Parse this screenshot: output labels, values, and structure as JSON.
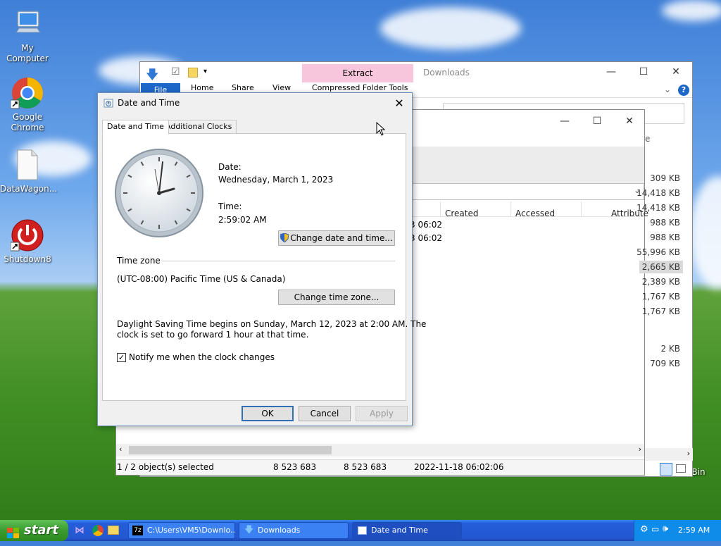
{
  "desktop": {
    "icons": [
      {
        "label": "My Computer",
        "icon": "computer-icon"
      },
      {
        "label": "Google Chrome",
        "icon": "chrome-icon"
      },
      {
        "label": "DataWagon...",
        "icon": "file-icon"
      },
      {
        "label": "Shutdown8",
        "icon": "power-icon"
      },
      {
        "label": "Bin",
        "icon": "recycle-bin-icon"
      }
    ]
  },
  "explorer": {
    "title": "Downloads",
    "context_tab": "Extract",
    "context_group": "Compressed Folder Tools",
    "ribbon_tabs": [
      "File",
      "Home",
      "Share",
      "View"
    ],
    "columns": [
      "Created",
      "Accessed",
      "Attribute"
    ],
    "rows_created": [
      "3 06:02",
      "3 06:02"
    ],
    "sizes": [
      "309 KB",
      "14,418 KB",
      "14,418 KB",
      "988 KB",
      "988 KB",
      "55,996 KB",
      "2,665 KB",
      "2,389 KB",
      "1,767 KB",
      "1,767 KB",
      "2 KB",
      "709 KB"
    ],
    "view_label": "e",
    "status": {
      "selection": "1 / 2 object(s) selected",
      "size1": "8 523 683",
      "size2": "8 523 683",
      "date": "2022-11-18 06:02:06"
    }
  },
  "dialog": {
    "title": "Date and Time",
    "tabs": [
      "Date and Time",
      "Additional Clocks"
    ],
    "date_label": "Date:",
    "date_value": "Wednesday, March 1, 2023",
    "time_label": "Time:",
    "time_value": "2:59:02 AM",
    "change_datetime_button": "Change date and time...",
    "timezone_heading": "Time zone",
    "timezone_value": "(UTC-08:00) Pacific Time (US & Canada)",
    "change_timezone_button": "Change time zone...",
    "dst_line1": "Daylight Saving Time begins on Sunday, March 12, 2023 at 2:00 AM. The",
    "dst_line2": "clock is set to go forward 1 hour at that time.",
    "notify_label": "Notify me when the clock changes",
    "notify_checked": true,
    "ok": "OK",
    "cancel": "Cancel",
    "apply": "Apply"
  },
  "taskbar": {
    "start_label": "start",
    "tasks": [
      {
        "label": "C:\\Users\\VM5\\Downlo...",
        "icon": "7zip-icon"
      },
      {
        "label": "Downloads",
        "icon": "download-arrow-icon"
      },
      {
        "label": "Date and Time",
        "icon": "date-time-icon"
      }
    ],
    "clock": "2:59 AM"
  },
  "colors": {
    "extract_tab": "#f7c6dc",
    "taskbar": "#245edb",
    "start_button": "#3a9b2e",
    "tray": "#0f8bea"
  }
}
